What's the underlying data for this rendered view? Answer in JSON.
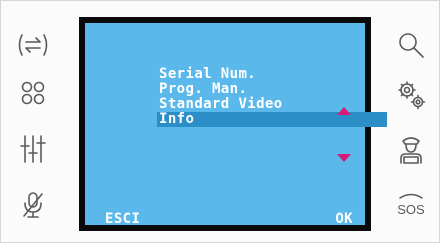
{
  "left_buttons": [
    {
      "icon": "call-transfer-icon"
    },
    {
      "icon": "dots-grid-icon"
    },
    {
      "icon": "sliders-icon"
    },
    {
      "icon": "mic-off-icon"
    }
  ],
  "right_buttons": [
    {
      "icon": "search-icon"
    },
    {
      "icon": "settings-gears-icon"
    },
    {
      "icon": "concierge-icon"
    },
    {
      "icon": "sos-icon",
      "label": "SOS"
    }
  ],
  "menu": {
    "items": [
      "Serial Num.",
      "Prog. Man.",
      "Standard Video",
      "Info"
    ],
    "selected_index": 3
  },
  "softkeys": {
    "left": "ESCI",
    "right": "OK"
  },
  "colors": {
    "screen_bg": "#5ab8ea",
    "selection": "#2b8ec6",
    "arrows": "#d81b78",
    "icons": "#5b5b5b"
  }
}
